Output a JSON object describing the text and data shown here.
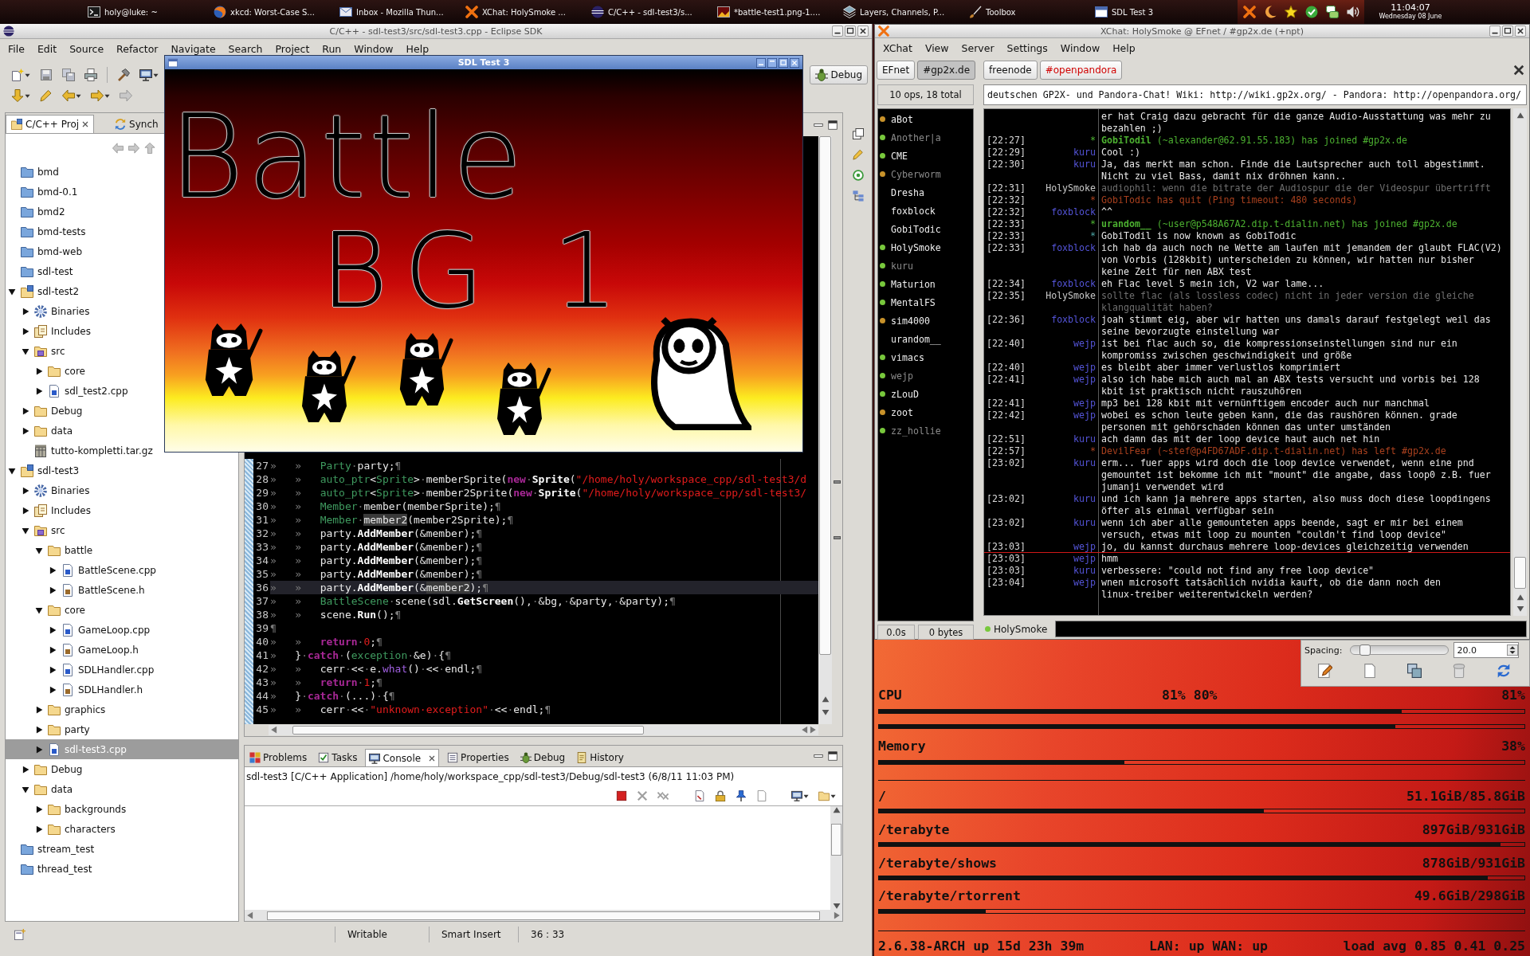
{
  "taskbar": {
    "tasks": [
      "holy@luke: ~",
      "xkcd: Worst-Case S...",
      "Inbox - Mozilla Thun...",
      "XChat: HolySmoke ...",
      "C/C++ - sdl-test3/s...",
      "*battle-test1.png-1....",
      "Layers, Channels, P...",
      "Toolbox",
      "SDL Test 3"
    ],
    "clock": {
      "time": "11:04:07",
      "date": "Wednesday 08 June"
    }
  },
  "eclipse": {
    "title": "C/C++ - sdl-test3/src/sdl-test3.cpp - Eclipse SDK",
    "menu": [
      "File",
      "Edit",
      "Source",
      "Refactor",
      "Navigate",
      "Search",
      "Project",
      "Run",
      "Window",
      "Help"
    ],
    "perspective": "Debug",
    "project_view": {
      "tabs": [
        {
          "label": "C/C++ Proj",
          "selected": true
        },
        {
          "label": "Synch",
          "selected": false
        }
      ],
      "tree": [
        {
          "label": "bmd",
          "kind": "closed-project",
          "selected": false
        },
        {
          "label": "bmd-0.1",
          "kind": "closed-project",
          "selected": false
        },
        {
          "label": "bmd2",
          "kind": "closed-project",
          "selected": false
        },
        {
          "label": "bmd-tests",
          "kind": "closed-project",
          "selected": false
        },
        {
          "label": "bmd-web",
          "kind": "closed-project",
          "selected": false
        },
        {
          "label": "sdl-test",
          "kind": "closed-project",
          "selected": false
        },
        {
          "label": "sdl-test2",
          "kind": "project",
          "selected": false,
          "expanded": true,
          "children": [
            {
              "label": "Binaries",
              "kind": "binaries",
              "selected": false,
              "expanded": false
            },
            {
              "label": "Includes",
              "kind": "includes",
              "selected": false,
              "expanded": false
            },
            {
              "label": "src",
              "kind": "source-folder",
              "selected": false,
              "expanded": true,
              "children": [
                {
                  "label": "core",
                  "kind": "folder",
                  "selected": false,
                  "expanded": false
                },
                {
                  "label": "sdl_test2.cpp",
                  "kind": "source-file",
                  "selected": false,
                  "expanded": false
                }
              ]
            },
            {
              "label": "Debug",
              "kind": "folder",
              "selected": false,
              "expanded": false
            },
            {
              "label": "data",
              "kind": "folder",
              "selected": false,
              "expanded": false
            },
            {
              "label": "tutto-kompletti.tar.gz",
              "kind": "archive",
              "selected": false
            }
          ]
        },
        {
          "label": "sdl-test3",
          "kind": "project",
          "selected": false,
          "expanded": true,
          "children": [
            {
              "label": "Binaries",
              "kind": "binaries",
              "selected": false,
              "expanded": false
            },
            {
              "label": "Includes",
              "kind": "includes",
              "selected": false,
              "expanded": false
            },
            {
              "label": "src",
              "kind": "source-folder",
              "selected": false,
              "expanded": true,
              "children": [
                {
                  "label": "battle",
                  "kind": "folder",
                  "selected": false,
                  "expanded": true,
                  "children": [
                    {
                      "label": "BattleScene.cpp",
                      "kind": "source-file",
                      "selected": false,
                      "expanded": false
                    },
                    {
                      "label": "BattleScene.h",
                      "kind": "header-file",
                      "selected": false,
                      "expanded": false
                    }
                  ]
                },
                {
                  "label": "core",
                  "kind": "folder",
                  "selected": false,
                  "expanded": true,
                  "children": [
                    {
                      "label": "GameLoop.cpp",
                      "kind": "source-file",
                      "selected": false,
                      "expanded": false
                    },
                    {
                      "label": "GameLoop.h",
                      "kind": "header-file",
                      "selected": false,
                      "expanded": false
                    },
                    {
                      "label": "SDLHandler.cpp",
                      "kind": "source-file",
                      "selected": false,
                      "expanded": false
                    },
                    {
                      "label": "SDLHandler.h",
                      "kind": "header-file",
                      "selected": false,
                      "expanded": false
                    }
                  ]
                },
                {
                  "label": "graphics",
                  "kind": "folder",
                  "selected": false,
                  "expanded": false
                },
                {
                  "label": "party",
                  "kind": "folder",
                  "selected": false,
                  "expanded": false
                },
                {
                  "label": "sdl-test3.cpp",
                  "kind": "source-file",
                  "selected": true,
                  "expanded": false
                }
              ]
            },
            {
              "label": "Debug",
              "kind": "folder",
              "selected": false,
              "expanded": false
            },
            {
              "label": "data",
              "kind": "folder",
              "selected": false,
              "expanded": true,
              "children": [
                {
                  "label": "backgrounds",
                  "kind": "folder",
                  "selected": false,
                  "expanded": false
                },
                {
                  "label": "characters",
                  "kind": "folder",
                  "selected": false,
                  "expanded": false
                }
              ]
            }
          ]
        },
        {
          "label": "stream_test",
          "kind": "closed-project",
          "selected": false
        },
        {
          "label": "thread_test",
          "kind": "closed-project",
          "selected": false
        }
      ]
    },
    "editor": {
      "lines": [
        {
          "number": "27",
          "current": false,
          "tokens": [
            {
              "kind": "ws",
              "text": "»\t»\t"
            },
            {
              "kind": "type",
              "text": "Party"
            },
            {
              "kind": "ws",
              "text": "·"
            },
            {
              "kind": "plain",
              "text": "party;"
            },
            {
              "kind": "ws",
              "text": "¶"
            }
          ]
        },
        {
          "number": "28",
          "current": false,
          "tokens": [
            {
              "kind": "ws",
              "text": "»\t»\t"
            },
            {
              "kind": "type",
              "text": "auto_ptr"
            },
            {
              "kind": "plain",
              "text": "<"
            },
            {
              "kind": "type",
              "text": "Sprite"
            },
            {
              "kind": "plain",
              "text": ">"
            },
            {
              "kind": "ws",
              "text": "·"
            },
            {
              "kind": "plain",
              "text": "memberSprite("
            },
            {
              "kind": "keyword",
              "text": "new"
            },
            {
              "kind": "ws",
              "text": "·"
            },
            {
              "kind": "method",
              "text": "Sprite"
            },
            {
              "kind": "plain",
              "text": "("
            },
            {
              "kind": "string",
              "text": "\"/home/holy/workspace_cpp/sdl-test3/d"
            }
          ]
        },
        {
          "number": "29",
          "current": false,
          "tokens": [
            {
              "kind": "ws",
              "text": "»\t»\t"
            },
            {
              "kind": "type",
              "text": "auto_ptr"
            },
            {
              "kind": "plain",
              "text": "<"
            },
            {
              "kind": "type",
              "text": "Sprite"
            },
            {
              "kind": "plain",
              "text": ">"
            },
            {
              "kind": "ws",
              "text": "·"
            },
            {
              "kind": "plain",
              "text": "member2Sprite("
            },
            {
              "kind": "keyword",
              "text": "new"
            },
            {
              "kind": "ws",
              "text": "·"
            },
            {
              "kind": "method",
              "text": "Sprite"
            },
            {
              "kind": "plain",
              "text": "("
            },
            {
              "kind": "string",
              "text": "\"/home/holy/workspace_cpp/sdl-test3/"
            }
          ]
        },
        {
          "number": "30",
          "current": false,
          "tokens": [
            {
              "kind": "ws",
              "text": "»\t»\t"
            },
            {
              "kind": "type",
              "text": "Member"
            },
            {
              "kind": "ws",
              "text": "·"
            },
            {
              "kind": "plain",
              "text": "member(memberSprite);"
            },
            {
              "kind": "ws",
              "text": "¶"
            }
          ]
        },
        {
          "number": "31",
          "current": false,
          "tokens": [
            {
              "kind": "ws",
              "text": "»\t»\t"
            },
            {
              "kind": "type",
              "text": "Member"
            },
            {
              "kind": "ws",
              "text": "·"
            },
            {
              "kind": "occurrence",
              "text": "member2"
            },
            {
              "kind": "plain",
              "text": "(member2Sprite);"
            },
            {
              "kind": "ws",
              "text": "¶"
            }
          ]
        },
        {
          "number": "32",
          "current": false,
          "tokens": [
            {
              "kind": "ws",
              "text": "»\t»\t"
            },
            {
              "kind": "plain",
              "text": "party."
            },
            {
              "kind": "method",
              "text": "AddMember"
            },
            {
              "kind": "plain",
              "text": "(&member);"
            },
            {
              "kind": "ws",
              "text": "¶"
            }
          ]
        },
        {
          "number": "33",
          "current": false,
          "tokens": [
            {
              "kind": "ws",
              "text": "»\t»\t"
            },
            {
              "kind": "plain",
              "text": "party."
            },
            {
              "kind": "method",
              "text": "AddMember"
            },
            {
              "kind": "plain",
              "text": "(&member);"
            },
            {
              "kind": "ws",
              "text": "¶"
            }
          ]
        },
        {
          "number": "34",
          "current": false,
          "tokens": [
            {
              "kind": "ws",
              "text": "»\t»\t"
            },
            {
              "kind": "plain",
              "text": "party."
            },
            {
              "kind": "method",
              "text": "AddMember"
            },
            {
              "kind": "plain",
              "text": "(&member);"
            },
            {
              "kind": "ws",
              "text": "¶"
            }
          ]
        },
        {
          "number": "35",
          "current": false,
          "tokens": [
            {
              "kind": "ws",
              "text": "»\t»\t"
            },
            {
              "kind": "plain",
              "text": "party."
            },
            {
              "kind": "method",
              "text": "AddMember"
            },
            {
              "kind": "plain",
              "text": "(&member);"
            },
            {
              "kind": "ws",
              "text": "¶"
            }
          ]
        },
        {
          "number": "36",
          "current": true,
          "tokens": [
            {
              "kind": "ws",
              "text": "»\t»\t"
            },
            {
              "kind": "plain",
              "text": "party."
            },
            {
              "kind": "method",
              "text": "AddMember"
            },
            {
              "kind": "plain",
              "text": "(&"
            },
            {
              "kind": "occurrence",
              "text": "member2"
            },
            {
              "kind": "plain",
              "text": ");"
            },
            {
              "kind": "ws",
              "text": "¶"
            }
          ]
        },
        {
          "number": "37",
          "current": false,
          "tokens": [
            {
              "kind": "ws",
              "text": "»\t»\t"
            },
            {
              "kind": "type",
              "text": "BattleScene"
            },
            {
              "kind": "ws",
              "text": "·"
            },
            {
              "kind": "plain",
              "text": "scene(sdl."
            },
            {
              "kind": "method",
              "text": "GetScreen"
            },
            {
              "kind": "plain",
              "text": "(),"
            },
            {
              "kind": "ws",
              "text": "·"
            },
            {
              "kind": "plain",
              "text": "&bg,"
            },
            {
              "kind": "ws",
              "text": "·"
            },
            {
              "kind": "plain",
              "text": "&party,"
            },
            {
              "kind": "ws",
              "text": "·"
            },
            {
              "kind": "plain",
              "text": "&party);"
            },
            {
              "kind": "ws",
              "text": "¶"
            }
          ]
        },
        {
          "number": "38",
          "current": false,
          "tokens": [
            {
              "kind": "ws",
              "text": "»\t»\t"
            },
            {
              "kind": "plain",
              "text": "scene."
            },
            {
              "kind": "method",
              "text": "Run"
            },
            {
              "kind": "plain",
              "text": "();"
            },
            {
              "kind": "ws",
              "text": "¶"
            }
          ]
        },
        {
          "number": "39",
          "current": false,
          "tokens": [
            {
              "kind": "ws",
              "text": "¶"
            }
          ]
        },
        {
          "number": "40",
          "current": false,
          "tokens": [
            {
              "kind": "ws",
              "text": "»\t»\t"
            },
            {
              "kind": "keyword",
              "text": "return"
            },
            {
              "kind": "ws",
              "text": "·"
            },
            {
              "kind": "number",
              "text": "0"
            },
            {
              "kind": "plain",
              "text": ";"
            },
            {
              "kind": "ws",
              "text": "¶"
            }
          ]
        },
        {
          "number": "41",
          "current": false,
          "tokens": [
            {
              "kind": "ws",
              "text": "»\t"
            },
            {
              "kind": "plain",
              "text": "}"
            },
            {
              "kind": "ws",
              "text": "·"
            },
            {
              "kind": "keyword",
              "text": "catch"
            },
            {
              "kind": "ws",
              "text": "·"
            },
            {
              "kind": "plain",
              "text": "("
            },
            {
              "kind": "type",
              "text": "exception"
            },
            {
              "kind": "ws",
              "text": "·"
            },
            {
              "kind": "plain",
              "text": "&e)"
            },
            {
              "kind": "ws",
              "text": "·"
            },
            {
              "kind": "plain",
              "text": "{"
            },
            {
              "kind": "ws",
              "text": "¶"
            }
          ]
        },
        {
          "number": "42",
          "current": false,
          "tokens": [
            {
              "kind": "ws",
              "text": "»\t»\t"
            },
            {
              "kind": "plain",
              "text": "cerr"
            },
            {
              "kind": "ws",
              "text": "·"
            },
            {
              "kind": "plain",
              "text": "<<"
            },
            {
              "kind": "ws",
              "text": "·"
            },
            {
              "kind": "plain",
              "text": "e."
            },
            {
              "kind": "call",
              "text": "what"
            },
            {
              "kind": "plain",
              "text": "()"
            },
            {
              "kind": "ws",
              "text": "·"
            },
            {
              "kind": "plain",
              "text": "<<"
            },
            {
              "kind": "ws",
              "text": "·"
            },
            {
              "kind": "plain",
              "text": "endl;"
            },
            {
              "kind": "ws",
              "text": "¶"
            }
          ]
        },
        {
          "number": "43",
          "current": false,
          "tokens": [
            {
              "kind": "ws",
              "text": "»\t»\t"
            },
            {
              "kind": "keyword",
              "text": "return"
            },
            {
              "kind": "ws",
              "text": "·"
            },
            {
              "kind": "number",
              "text": "1"
            },
            {
              "kind": "plain",
              "text": ";"
            },
            {
              "kind": "ws",
              "text": "¶"
            }
          ]
        },
        {
          "number": "44",
          "current": false,
          "tokens": [
            {
              "kind": "ws",
              "text": "»\t"
            },
            {
              "kind": "plain",
              "text": "}"
            },
            {
              "kind": "ws",
              "text": "·"
            },
            {
              "kind": "keyword",
              "text": "catch"
            },
            {
              "kind": "ws",
              "text": "·"
            },
            {
              "kind": "plain",
              "text": "(...)"
            },
            {
              "kind": "ws",
              "text": "·"
            },
            {
              "kind": "plain",
              "text": "{"
            },
            {
              "kind": "ws",
              "text": "¶"
            }
          ]
        },
        {
          "number": "45",
          "current": false,
          "tokens": [
            {
              "kind": "ws",
              "text": "»\t»\t"
            },
            {
              "kind": "plain",
              "text": "cerr"
            },
            {
              "kind": "ws",
              "text": "·"
            },
            {
              "kind": "plain",
              "text": "<<"
            },
            {
              "kind": "ws",
              "text": "·"
            },
            {
              "kind": "string",
              "text": "\"unknown·exception\""
            },
            {
              "kind": "ws",
              "text": "·"
            },
            {
              "kind": "plain",
              "text": "<<"
            },
            {
              "kind": "ws",
              "text": "·"
            },
            {
              "kind": "plain",
              "text": "endl;"
            },
            {
              "kind": "ws",
              "text": "¶"
            }
          ]
        }
      ]
    },
    "bottom_panel": {
      "tabs": [
        {
          "label": "Problems",
          "selected": false
        },
        {
          "label": "Tasks",
          "selected": false
        },
        {
          "label": "Console",
          "selected": true
        },
        {
          "label": "Properties",
          "selected": false
        },
        {
          "label": "Debug",
          "selected": false
        },
        {
          "label": "History",
          "selected": false
        }
      ],
      "description": "sdl-test3 [C/C++ Application] /home/holy/workspace_cpp/sdl-test3/Debug/sdl-test3 (6/8/11 11:03 PM)"
    },
    "status_bar": {
      "mode": "Writable",
      "insert_mode": "Smart Insert",
      "position": "36 : 33"
    }
  },
  "sdl_window": {
    "title": "SDL Test 3",
    "canvas_text": [
      "Battle",
      "BG 1"
    ]
  },
  "xchat": {
    "title": "XChat: HolySmoke @ EFnet / #gp2x.de (+npt)",
    "menu": [
      "XChat",
      "View",
      "Server",
      "Settings",
      "Window",
      "Help"
    ],
    "networks": [
      {
        "server": {
          "label": "EFnet",
          "selected": false
        },
        "channels": [
          {
            "label": "#gp2x.de",
            "selected": true,
            "unread": false
          }
        ]
      },
      {
        "server": {
          "label": "freenode",
          "selected": false
        },
        "channels": [
          {
            "label": "#openpandora",
            "selected": false,
            "unread": true
          }
        ]
      }
    ],
    "user_count": "10 ops, 18 total",
    "topic": "deutschen GP2X- und Pandora-Chat! Wiki: http://wiki.gp2x.org/ - Pandora: http://openpandora.org/",
    "nicks": [
      {
        "name": "aBot",
        "color": "#c8922a",
        "away": false
      },
      {
        "name": "Another|a",
        "color": "#78c83c",
        "away": true
      },
      {
        "name": "CME",
        "color": "#78c83c",
        "away": false
      },
      {
        "name": "Cyberworm",
        "color": "#c8922a",
        "away": true
      },
      {
        "name": "Dresha",
        "away": false
      },
      {
        "name": "foxblock",
        "away": false
      },
      {
        "name": "GobiTodic",
        "away": false
      },
      {
        "name": "HolySmoke",
        "color": "#78c83c",
        "away": false
      },
      {
        "name": "kuru",
        "color": "#78c83c",
        "away": true
      },
      {
        "name": "Maturion",
        "color": "#78c83c",
        "away": false
      },
      {
        "name": "MentalFS",
        "color": "#78c83c",
        "away": false
      },
      {
        "name": "sim4000",
        "color": "#c8922a",
        "away": false
      },
      {
        "name": "urandom__",
        "away": false
      },
      {
        "name": "vimacs",
        "color": "#78c83c",
        "away": false
      },
      {
        "name": "wejp",
        "color": "#78c83c",
        "away": true
      },
      {
        "name": "zLouD",
        "color": "#78c83c",
        "away": false
      },
      {
        "name": "zoot",
        "color": "#c8922a",
        "away": false
      },
      {
        "name": "zz_hollie",
        "color": "#78c83c",
        "away": true
      }
    ],
    "lag": "0.0s",
    "throughput": "0 bytes",
    "messages": [
      {
        "text": "er hat Craig dazu gebracht für die ganze Audio-Ausstattung was mehr zu bezahlen ;)",
        "kind": "message",
        "marker_above": false
      },
      {
        "time": "[22:27]",
        "nick": "*",
        "text": "**GobiTodil** (~alexander@62.91.55.183) has joined #gp2x.de",
        "kind": "join",
        "marker_above": false
      },
      {
        "time": "[22:29]",
        "nick": "kuru",
        "text": "Cool :)",
        "kind": "message",
        "marker_above": false
      },
      {
        "time": "[22:30]",
        "nick": "kuru",
        "text": "Ja, das merkt man schon. Finde die Lautsprecher auch toll abgestimmt. Nicht zu viel Bass, damit nix dröhnen kann..",
        "kind": "message",
        "marker_above": false
      },
      {
        "time": "[22:31]",
        "nick": "HolySmoke",
        "text": "audiophil: wenn die bitrate der Audiospur die der Videospur übertrifft",
        "kind": "own",
        "marker_above": false
      },
      {
        "time": "[22:32]",
        "nick": "*",
        "text": "GobiTodic has quit (Ping timeout: 480 seconds)",
        "kind": "part",
        "marker_above": false
      },
      {
        "time": "[22:32]",
        "nick": "foxblock",
        "text": "^^",
        "kind": "message",
        "marker_above": false
      },
      {
        "time": "[22:33]",
        "nick": "*",
        "text": "**urandom__** (~user@p548A67A2.dip.t-dialin.net) has joined #gp2x.de",
        "kind": "join",
        "marker_above": false
      },
      {
        "time": "[22:33]",
        "nick": "*",
        "text": "GobiTodil is now known as GobiTodic",
        "kind": "nick-change",
        "marker_above": false
      },
      {
        "time": "[22:33]",
        "nick": "foxblock",
        "text": "ich hab da auch noch ne Wette am laufen mit jemandem der glaubt FLAC(V2) von Vorbis (128kbit) unterscheiden zu können, wir hatten nur bisher keine Zeit für nen ABX test",
        "kind": "message",
        "marker_above": false
      },
      {
        "time": "[22:34]",
        "nick": "foxblock",
        "text": "eh Flac level 5 mein ich, V2 war lame...",
        "kind": "message",
        "marker_above": false
      },
      {
        "time": "[22:35]",
        "nick": "HolySmoke",
        "text": "sollte flac (als lossless codec) nicht in jeder version die gleiche klangqualität haben?",
        "kind": "own",
        "marker_above": false
      },
      {
        "time": "[22:36]",
        "nick": "foxblock",
        "text": "joah stimmt eig, aber wir hatten uns damals darauf festgelegt weil das seine bevorzugte einstellung war",
        "kind": "message",
        "marker_above": false
      },
      {
        "time": "[22:40]",
        "nick": "wejp",
        "text": "ist bei flac auch so, die kompressionseinstellungen sind nur ein kompromiss zwischen geschwindigkeit und größe",
        "kind": "message",
        "marker_above": false
      },
      {
        "time": "[22:40]",
        "nick": "wejp",
        "text": "es bleibt aber immer verlustlos komprimiert",
        "kind": "message",
        "marker_above": false
      },
      {
        "time": "[22:41]",
        "nick": "wejp",
        "text": "also ich habe mich auch mal an ABX tests versucht und vorbis bei 128 kbit ist praktisch nicht rauszuhören",
        "kind": "message",
        "marker_above": false
      },
      {
        "time": "[22:41]",
        "nick": "wejp",
        "text": "mp3 bei 128 kbit mit vernünftigem encoder auch nur manchmal",
        "kind": "message",
        "marker_above": false
      },
      {
        "time": "[22:42]",
        "nick": "wejp",
        "text": "wobei es schon leute geben kann, die das raushören können. grade personen mit gehörschaden können das unter umständen",
        "kind": "message",
        "marker_above": false
      },
      {
        "time": "[22:51]",
        "nick": "kuru",
        "text": "ach damn das mit der loop device haut auch net hin",
        "kind": "message",
        "marker_above": false
      },
      {
        "time": "[22:57]",
        "nick": "*",
        "text": "DevilFear (~stef@p4FD67ADF.dip.t-dialin.net) has left #gp2x.de",
        "kind": "part",
        "marker_above": false
      },
      {
        "time": "[23:02]",
        "nick": "kuru",
        "text": "erm... fuer apps wird doch die loop device verwendet, wenn eine pnd gemountet ist bekomme ich mit \"mount\" die angabe, dass loop0 z.B. fuer jumanji verwendet wird",
        "kind": "message",
        "marker_above": false
      },
      {
        "time": "[23:02]",
        "nick": "kuru",
        "text": "und ich kann ja mehrere apps starten, also muss doch diese loopdingens öfter als einmal verfügbar sein",
        "kind": "message",
        "marker_above": false
      },
      {
        "time": "[23:02]",
        "nick": "kuru",
        "text": "wenn ich aber alle gemounteten apps beende, sagt er mir bei einem versuch, etwas mit loop zu mounten \"couldn't find loop device\"",
        "kind": "message",
        "marker_above": false
      },
      {
        "time": "[23:03]",
        "nick": "wejp",
        "text": "jo, du kannst durchaus mehrere loop-devices gleichzeitig verwenden",
        "kind": "message",
        "marker_above": false
      },
      {
        "time": "[23:03]",
        "nick": "wejp",
        "text": "hmm",
        "kind": "message",
        "marker_above": true
      },
      {
        "time": "[23:03]",
        "nick": "kuru",
        "text": "verbessere: \"could not find any free loop device\"",
        "kind": "message",
        "marker_above": false
      },
      {
        "time": "[23:04]",
        "nick": "wejp",
        "text": "wnen microsoft tatsächlich nvidia kauft, ob die dann noch den linux-treiber weiterentwickeln werden?",
        "kind": "message",
        "marker_above": false
      }
    ],
    "input": {
      "nick": "HolySmoke"
    }
  },
  "gimp_dock": {
    "spacing_label": "Spacing:",
    "spacing_value": "20.0",
    "slider": {
      "level": 0.1
    }
  },
  "conky": {
    "cpu": {
      "label": "CPU",
      "cores": "81% 80%",
      "total": "81%",
      "bars": [
        {
          "level": 0.81
        },
        {
          "level": 0.8
        }
      ]
    },
    "memory": {
      "label": "Memory",
      "usage": "38%",
      "level": 0.38
    },
    "disks": [
      {
        "mount": "/",
        "usage": "51.1GiB/85.8GiB",
        "level": 0.596
      },
      {
        "mount": "/terabyte",
        "usage": "897GiB/931GiB",
        "level": 0.963
      },
      {
        "mount": "/terabyte/shows",
        "usage": "878GiB/931GiB",
        "level": 0.943
      },
      {
        "mount": "/terabyte/rtorrent",
        "usage": "49.6GiB/298GiB",
        "level": 0.166
      }
    ],
    "footer": {
      "kernel": "2.6.38-ARCH up 15d 23h 39m",
      "network": "LAN: up WAN: up",
      "load": "load avg 0.85 0.41 0.25"
    }
  }
}
